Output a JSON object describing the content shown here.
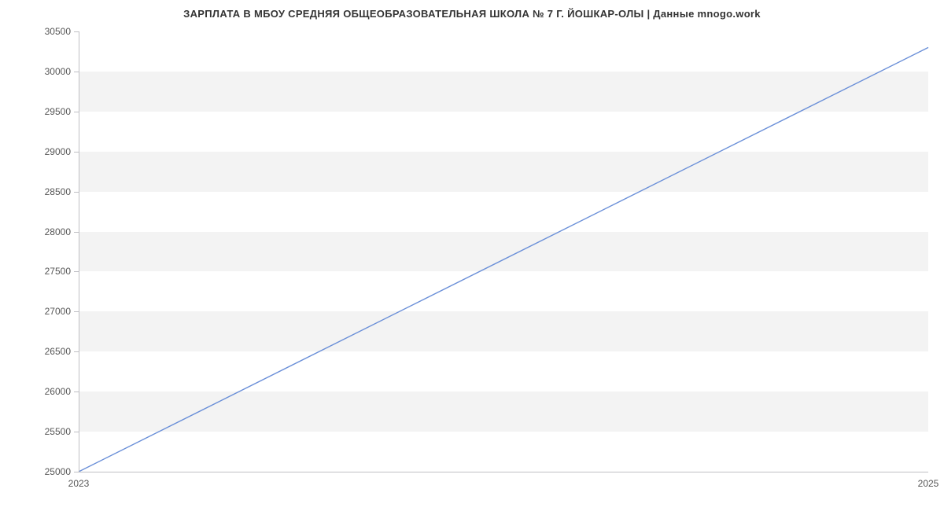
{
  "chart_data": {
    "type": "line",
    "title": "ЗАРПЛАТА В МБОУ СРЕДНЯЯ ОБЩЕОБРАЗОВАТЕЛЬНАЯ ШКОЛА № 7 Г. ЙОШКАР-ОЛЫ | Данные mnogo.work",
    "x": [
      2023,
      2025
    ],
    "values": [
      25000,
      30300
    ],
    "xlabel": "",
    "ylabel": "",
    "xlim": [
      2023,
      2025
    ],
    "ylim": [
      25000,
      30500
    ],
    "x_ticks": [
      2023,
      2025
    ],
    "y_ticks": [
      25000,
      25500,
      26000,
      26500,
      27000,
      27500,
      28000,
      28500,
      29000,
      29500,
      30000,
      30500
    ],
    "line_color": "#6a8fd8",
    "band_color": "#f3f3f3"
  }
}
